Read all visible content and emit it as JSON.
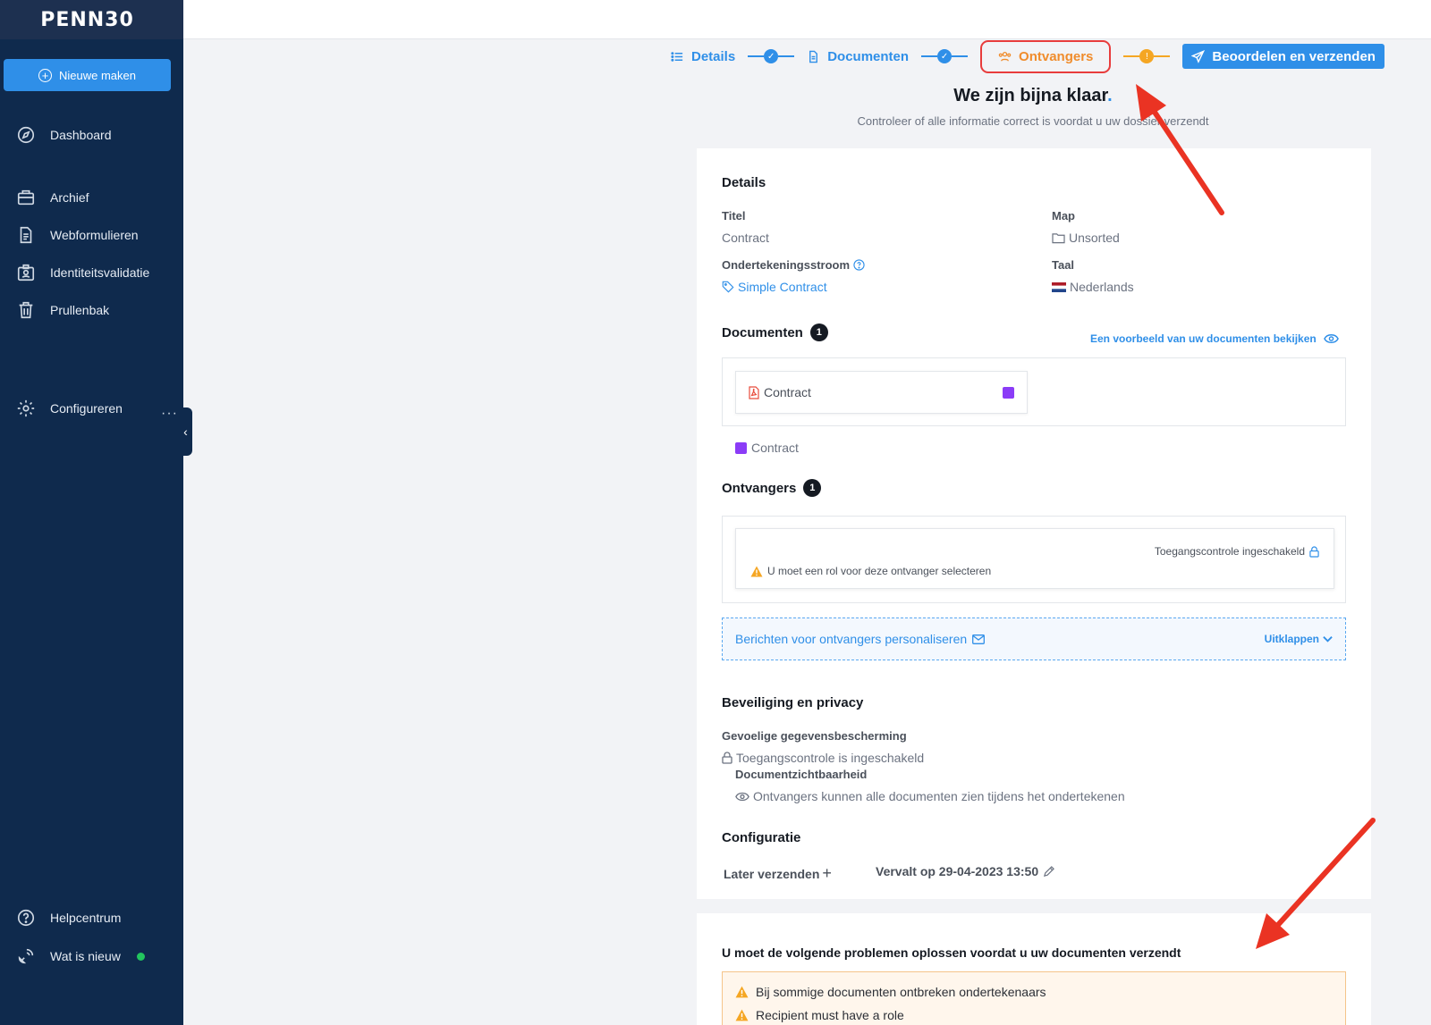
{
  "sidebar": {
    "logo": "PENN30",
    "new_button": "Nieuwe maken",
    "items": [
      {
        "label": "Dashboard"
      },
      {
        "label": "Archief"
      },
      {
        "label": "Webformulieren"
      },
      {
        "label": "Identiteitsvalidatie"
      },
      {
        "label": "Prullenbak"
      },
      {
        "label": "Configureren"
      },
      {
        "label": "Helpcentrum"
      },
      {
        "label": "Wat is nieuw"
      }
    ],
    "more": "···",
    "collapse": "‹"
  },
  "stepper": {
    "steps": [
      "Details",
      "Documenten",
      "Ontvangers",
      "Beoordelen en verzenden"
    ],
    "check": "✓",
    "warn": "!"
  },
  "header": {
    "title": "We zijn bijna klaar",
    "title_dot": ".",
    "subtitle": "Controleer of alle informatie correct is voordat u uw dossier verzendt"
  },
  "details": {
    "section_title": "Details",
    "title_label": "Titel",
    "title_value": "Contract",
    "map_label": "Map",
    "map_value": "Unsorted",
    "flow_label": "Ondertekeningsstroom",
    "flow_value": "Simple Contract",
    "lang_label": "Taal",
    "lang_value": "Nederlands"
  },
  "documents": {
    "section_title": "Documenten",
    "count": "1",
    "preview_link": "Een voorbeeld van uw documenten bekijken",
    "doc_name": "Contract",
    "legend_label": "Contract"
  },
  "recipients": {
    "section_title": "Ontvangers",
    "count": "1",
    "access_control": "Toegangscontrole ingeschakeld",
    "warning": "U moet een rol voor deze ontvanger selecteren",
    "personalize": "Berichten voor ontvangers personaliseren",
    "expand": "Uitklappen"
  },
  "security": {
    "section_title": "Beveiliging en privacy",
    "sensitive_label": "Gevoelige gegevensbescherming",
    "sensitive_value": "Toegangscontrole is ingeschakeld",
    "visibility_label": "Documentzichtbaarheid",
    "visibility_value": "Ontvangers kunnen alle documenten zien tijdens het ondertekenen"
  },
  "configuration": {
    "section_title": "Configuratie",
    "send_later": "Later verzenden",
    "plus": "+",
    "expires": "Vervalt op 29-04-2023 13:50"
  },
  "issues": {
    "title": "U moet de volgende problemen oplossen voordat u uw documenten verzendt",
    "items": [
      "Bij sommige documenten ontbreken ondertekenaars",
      "Recipient must have a role"
    ]
  },
  "colors": {
    "sidebar_bg": "#0f2a4d",
    "accent": "#2f8fe8",
    "warning": "#f08c2c",
    "annotation": "#e83c3c",
    "document_tag": "#8b3cf7"
  }
}
